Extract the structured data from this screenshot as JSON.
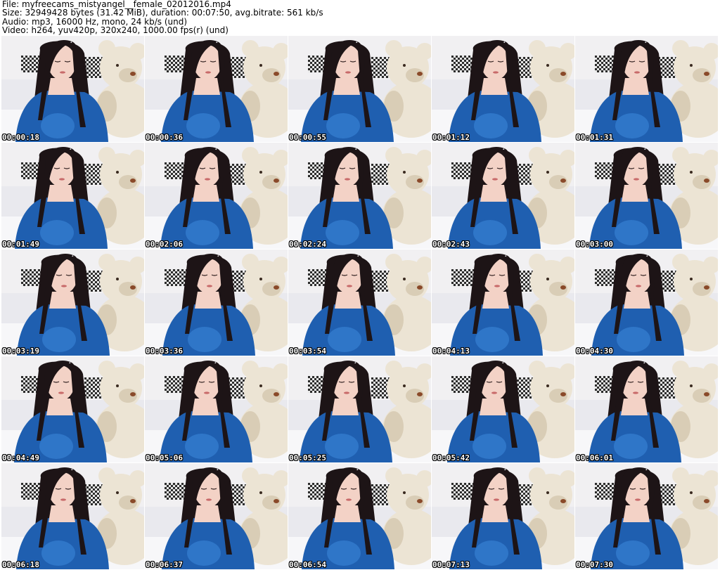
{
  "header": {
    "file_line": "File: myfreecams_mistyangel__female_02012016.mp4",
    "size_line": "Size: 32949428 bytes (31.42 MiB), duration: 00:07:50, avg.bitrate: 561 kb/s",
    "audio_line": "Audio: mp3, 16000 Hz, mono, 24 kb/s (und)",
    "video_line": "Video: h264, yuv420p, 320x240, 1000.00 fps(r) (und)"
  },
  "colors": {
    "wall": "#f1f0f2",
    "sofa": "#e9e9ee",
    "teddy": "#ece4d4",
    "teddy_shadow": "#d9cdb6",
    "hair": "#1d1416",
    "top": "#1f5fb0",
    "top_highlight": "#2f76c8",
    "skin": "#f3d2c6",
    "pillow_dark": "#2c2c2c",
    "pillow_light": "#e8e8e8"
  },
  "thumbnails": [
    {
      "timestamp": "00:00:18"
    },
    {
      "timestamp": "00:00:36"
    },
    {
      "timestamp": "00:00:55"
    },
    {
      "timestamp": "00:01:12"
    },
    {
      "timestamp": "00:01:31"
    },
    {
      "timestamp": "00:01:49"
    },
    {
      "timestamp": "00:02:06"
    },
    {
      "timestamp": "00:02:24"
    },
    {
      "timestamp": "00:02:43"
    },
    {
      "timestamp": "00:03:00"
    },
    {
      "timestamp": "00:03:19"
    },
    {
      "timestamp": "00:03:36"
    },
    {
      "timestamp": "00:03:54"
    },
    {
      "timestamp": "00:04:13"
    },
    {
      "timestamp": "00:04:30"
    },
    {
      "timestamp": "00:04:49"
    },
    {
      "timestamp": "00:05:06"
    },
    {
      "timestamp": "00:05:25"
    },
    {
      "timestamp": "00:05:42"
    },
    {
      "timestamp": "00:06:01"
    },
    {
      "timestamp": "00:06:18"
    },
    {
      "timestamp": "00:06:37"
    },
    {
      "timestamp": "00:06:54"
    },
    {
      "timestamp": "00:07:13"
    },
    {
      "timestamp": "00:07:30"
    }
  ]
}
